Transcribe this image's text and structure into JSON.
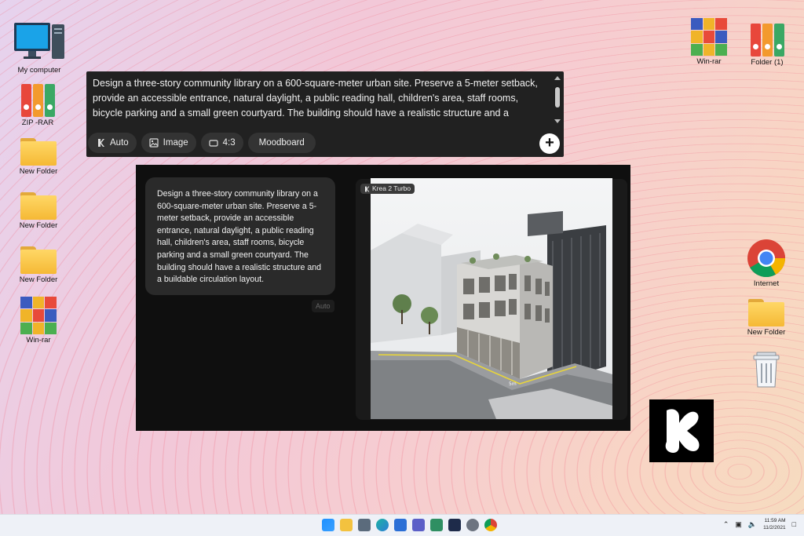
{
  "desktop": {
    "left_icons": [
      {
        "label": "My computer"
      },
      {
        "label": "ZIP -RAR"
      },
      {
        "label": "New Folder"
      },
      {
        "label": "New Folder"
      },
      {
        "label": "New Folder"
      },
      {
        "label": "Win-rar"
      }
    ],
    "right_icons": [
      {
        "label": "Win-rar"
      },
      {
        "label": "Folder (1)"
      },
      {
        "label": "Internet"
      },
      {
        "label": "New Folder"
      }
    ]
  },
  "prompt": {
    "text": "Design a three-story community library on a 600-square-meter urban site. Preserve a 5-meter setback, provide an accessible entrance, natural daylight, a public reading hall, children's area, staff rooms, bicycle parking and a small green courtyard. The building should have a realistic structure and a buildable circulation layout.",
    "toolbar": {
      "auto_label": "Auto",
      "image_label": "Image",
      "ratio_label": "4:3",
      "moodboard_label": "Moodboard"
    },
    "submit_symbol": "+"
  },
  "conversation": {
    "message": "Design a three-story community library on a 600-square-meter urban site. Preserve a 5-meter setback, provide an accessible entrance, natural daylight, a public reading hall, children's area, staff rooms, bicycle parking and a small green courtyard. The building should have a realistic structure and a buildable circulation layout.",
    "mode_tag": "Auto",
    "model_tag": "Krea 2 Turbo",
    "setback_label": "5m"
  },
  "taskbar": {
    "time": "11:59 AM",
    "date": "11/2/2021"
  },
  "colors": {
    "panel_bg": "#0f0f0f",
    "bubble_bg": "#2a2a2a",
    "chip_bg": "#333333",
    "prompt_bg": "#212121"
  }
}
